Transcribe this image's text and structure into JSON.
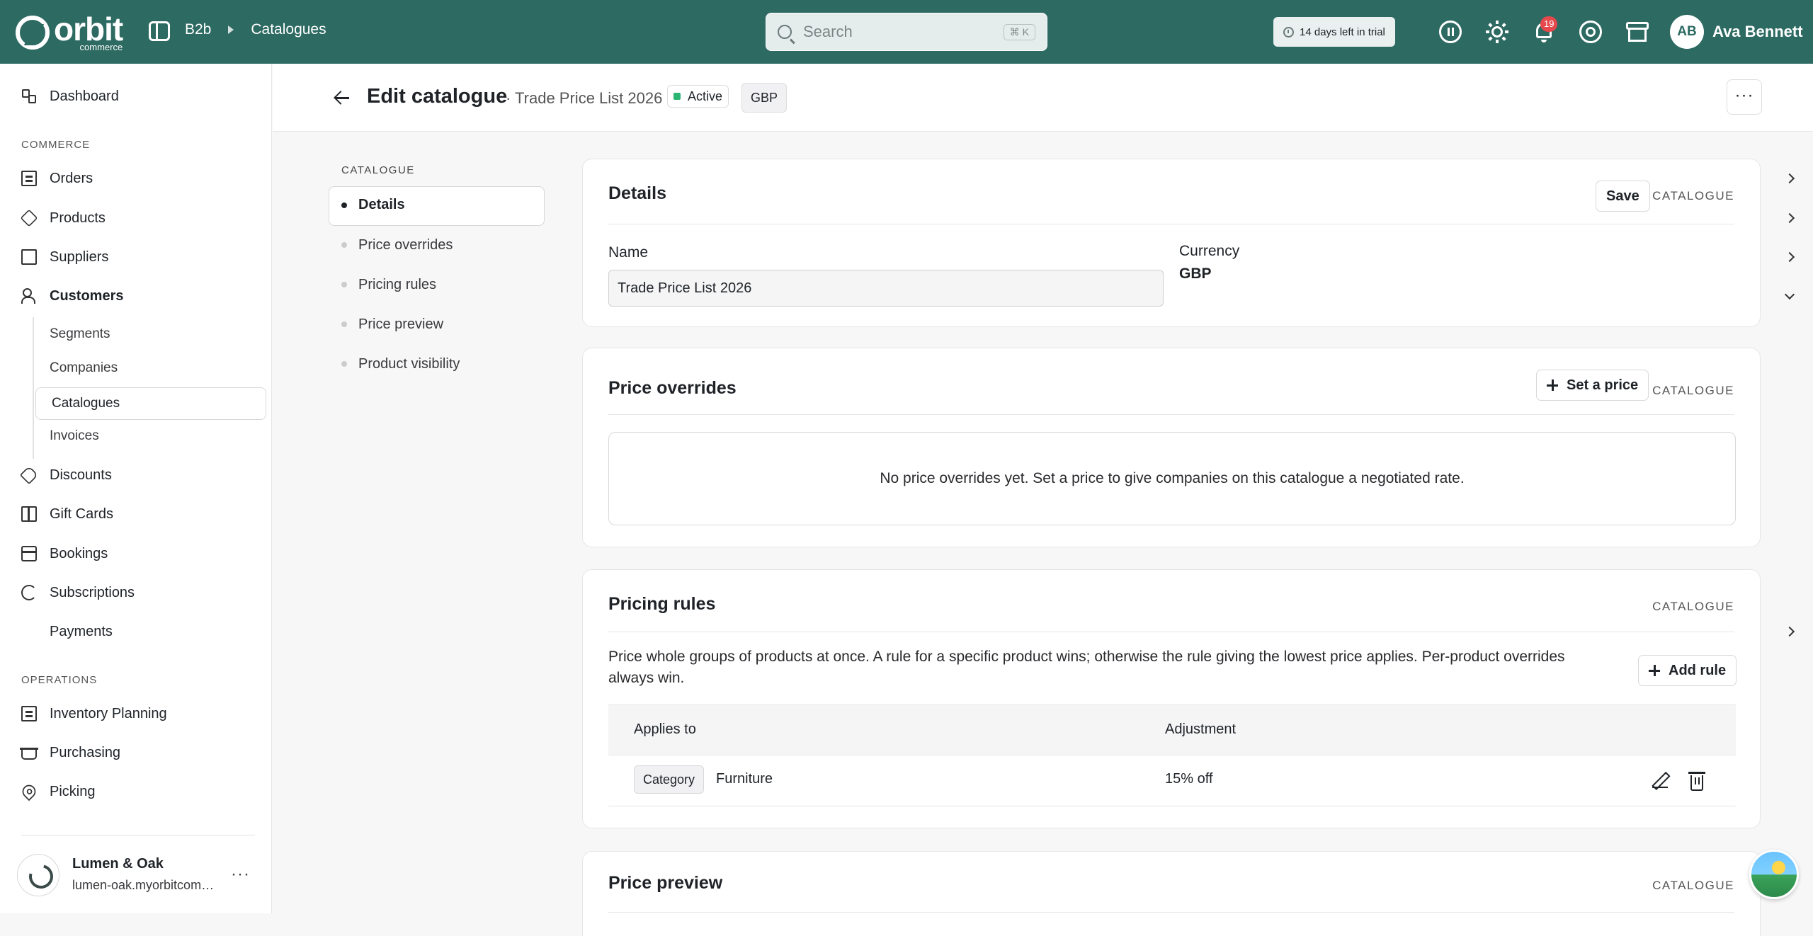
{
  "topbar": {
    "logo_word": "orbit",
    "logo_sub": "commerce",
    "breadcrumb": [
      "B2b",
      "Catalogues"
    ],
    "search_placeholder": "Search",
    "search_shortcut": "⌘ K",
    "trial_text": "14 days left in trial",
    "notifications_count": "19",
    "user_initials": "AB",
    "user_name": "Ava Bennett",
    "icons": [
      "sidebar-toggle-icon",
      "pause-icon",
      "sun-icon",
      "bell-icon",
      "help-icon",
      "store-icon"
    ]
  },
  "sidebar": {
    "dashboard": "Dashboard",
    "commerce_label": "COMMERCE",
    "orders": "Orders",
    "products": "Products",
    "suppliers": "Suppliers",
    "customers": "Customers",
    "customers_sub": [
      "Segments",
      "Companies",
      "Catalogues",
      "Invoices"
    ],
    "discounts": "Discounts",
    "gift_cards": "Gift Cards",
    "bookings": "Bookings",
    "subscriptions": "Subscriptions",
    "payments": "Payments",
    "operations_label": "OPERATIONS",
    "inventory_planning": "Inventory Planning",
    "purchasing": "Purchasing",
    "picking": "Picking",
    "store_name": "Lumen & Oak",
    "store_domain": "lumen-oak.myorbitcommerce.com",
    "more": "···"
  },
  "page": {
    "title": "Edit catalogue",
    "subtitle": "· Trade Price List 2026",
    "status": "Active",
    "status_color": "#2bb673",
    "currency_pill": "GBP",
    "more": "···"
  },
  "secondary_nav": {
    "label": "CATALOGUE",
    "items": [
      "Details",
      "Price overrides",
      "Pricing rules",
      "Price preview",
      "Product visibility"
    ],
    "active": "Details"
  },
  "details": {
    "title": "Details",
    "save": "Save",
    "tag": "CATALOGUE",
    "name_label": "Name",
    "name_value": "Trade Price List 2026",
    "currency_label": "Currency",
    "currency_value": "GBP"
  },
  "overrides": {
    "title": "Price overrides",
    "button": "Set a price",
    "tag": "CATALOGUE",
    "empty": "No price overrides yet. Set a price to give companies on this catalogue a negotiated rate."
  },
  "rules": {
    "title": "Pricing rules",
    "tag": "CATALOGUE",
    "description": "Price whole groups of products at once. A rule for a specific product wins; otherwise the rule giving the lowest price applies. Per-product overrides always win.",
    "button": "Add rule",
    "columns": [
      "Applies to",
      "Adjustment"
    ],
    "rows": [
      {
        "type": "Category",
        "target": "Furniture",
        "adjustment": "15% off"
      }
    ]
  },
  "preview": {
    "title": "Price preview",
    "tag": "CATALOGUE"
  },
  "colors": {
    "topbar": "#2d6a62",
    "danger_badge": "#e5484d"
  }
}
